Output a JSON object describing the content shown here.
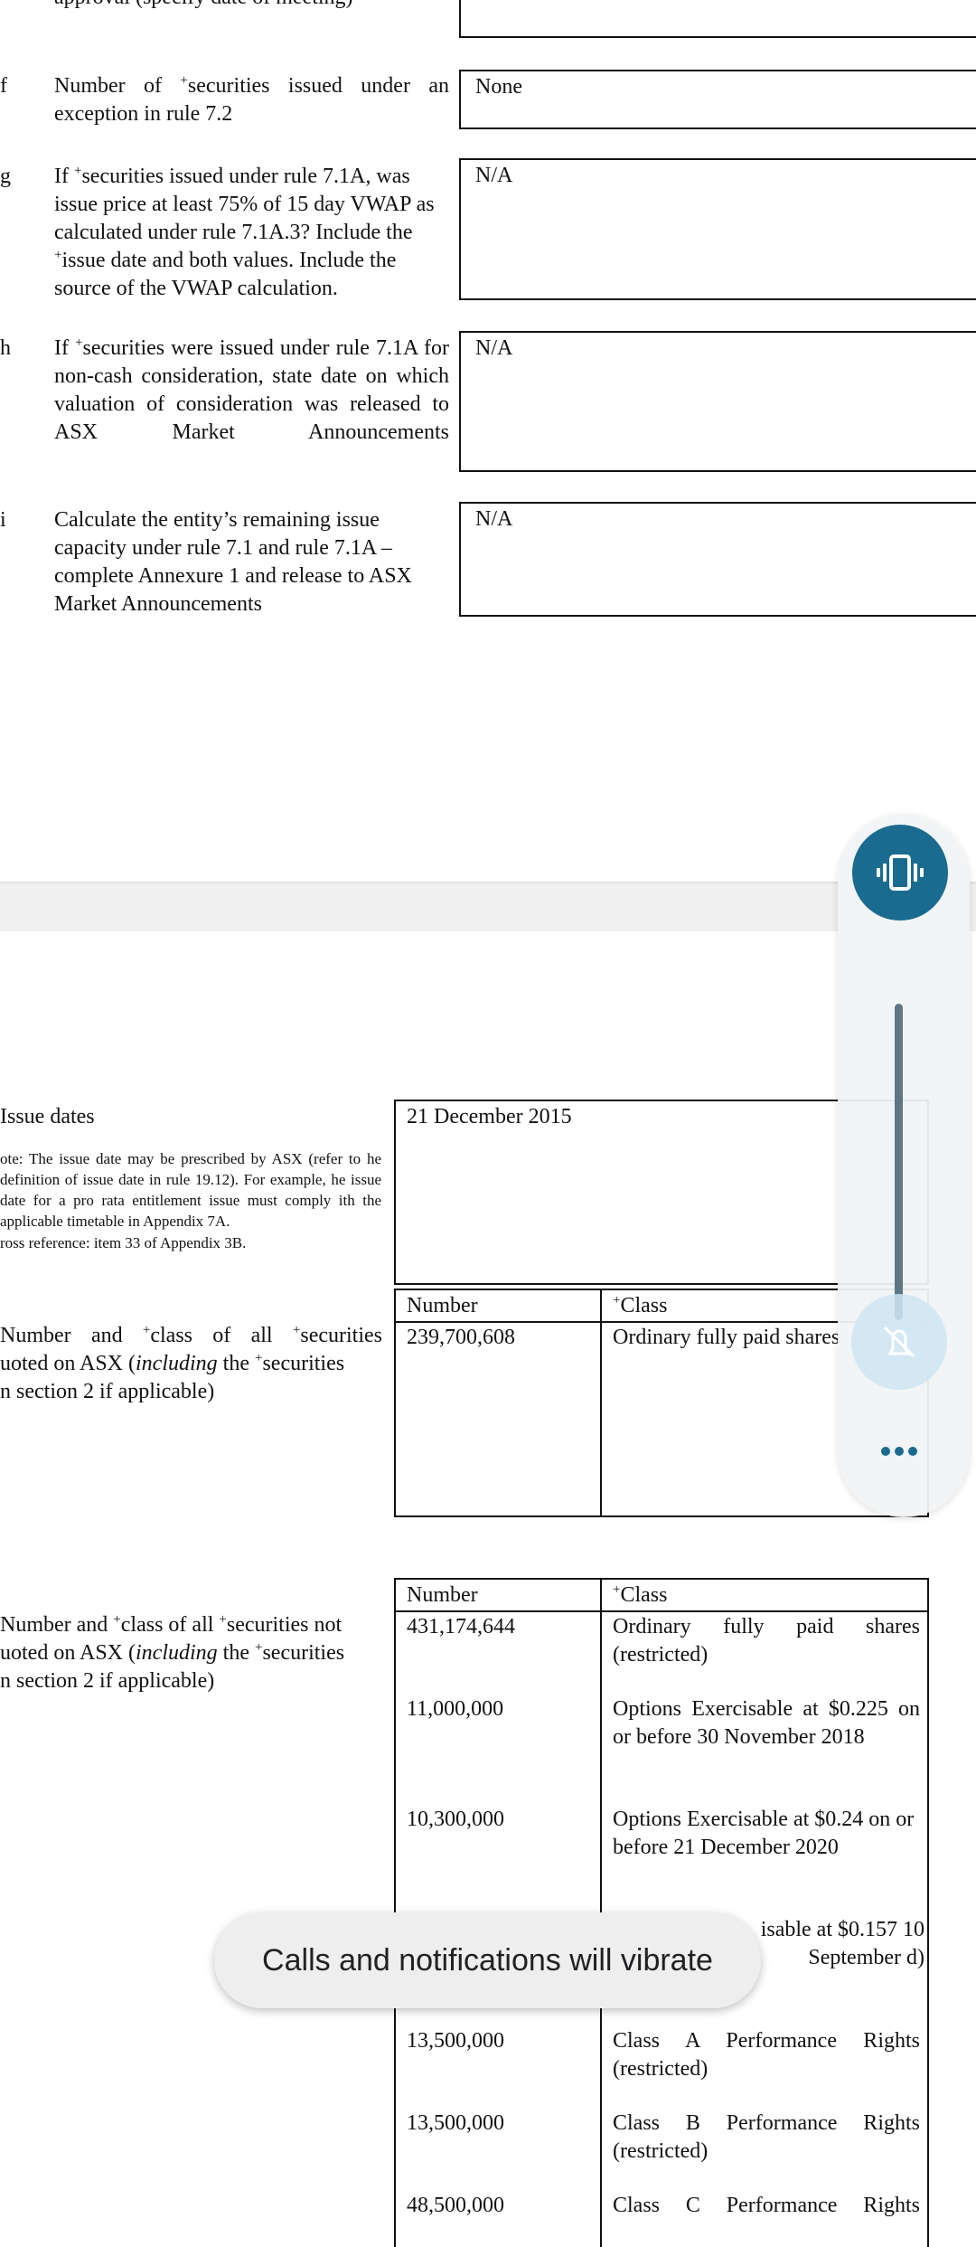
{
  "page1": {
    "cut_top_text": "approval (specify date of meeting)",
    "rows": [
      {
        "letter": "f",
        "pre": "Number of ",
        "sup": "+",
        "post": "securities issued under an exception in rule 7.2",
        "value": "None"
      },
      {
        "letter": "g",
        "pre": "If ",
        "sup": "+",
        "post": "securities issued under rule 7.1A, was issue price at least 75% of 15 day VWAP as calculated under rule 7.1A.3? Include the ",
        "sup2": "+",
        "post2": "issue date and both values. Include the source of the VWAP calculation.",
        "value": "N/A"
      },
      {
        "letter": "h",
        "pre": "If ",
        "sup": "+",
        "post": "securities were issued under rule 7.1A for non-cash consideration, state date on which valuation of consideration was released to ASX Market Announcements",
        "value": "N/A"
      },
      {
        "letter": "i",
        "pre": "Calculate the entity’s remaining issue capacity under rule 7.1 and rule 7.1A – complete Annexure 1 and release to ASX Market Announcements",
        "value": "N/A"
      }
    ]
  },
  "page2": {
    "issue_dates_label": "Issue dates",
    "issue_dates_note": "ote: The issue date may be prescribed by ASX (refer to he definition of issue date in rule 19.12). For example, he issue date for a pro rata entitlement issue must comply ith the applicable timetable in Appendix 7A.",
    "issue_dates_cross": "ross reference: item 33 of Appendix 3B.",
    "issue_date_value": "21 December 2015",
    "quoted": {
      "label_lines": [
        "Number and ",
        "class of all ",
        "securities",
        "uoted on ASX (",
        "including",
        " the ",
        "securities",
        "n section 2 if applicable)"
      ],
      "header_number": "Number",
      "header_class": "Class",
      "rows": [
        {
          "number": "239,700,608",
          "class": "Ordinary fully paid shares"
        }
      ]
    },
    "not_quoted": {
      "header_number": "Number",
      "header_class": "Class",
      "rows": [
        {
          "number": "431,174,644",
          "class": "Ordinary fully paid shares (restricted)"
        },
        {
          "number": "11,000,000",
          "class": "Options Exercisable at $0.225 on or before 30 November 2018"
        },
        {
          "number": "10,300,000",
          "class": "Options Exercisable at $0.24 on or before 21 December 2020"
        },
        {
          "number": "",
          "class": "isable at $0.157 10 September d)"
        },
        {
          "number": "13,500,000",
          "class": "Class A Performance Rights (restricted)"
        },
        {
          "number": "13,500,000",
          "class": "Class B Performance Rights (restricted)"
        },
        {
          "number": "48,500,000",
          "class": "Class C Performance Rights"
        }
      ]
    }
  },
  "volume_panel": {
    "mode_icon": "vibrate-icon",
    "mute_icon": "notifications-off-icon",
    "more_icon": "more-dots-icon"
  },
  "toast": {
    "text": "Calls and notifications will vibrate"
  },
  "colors": {
    "accent": "#1a6b8f",
    "panel_bg": "#f1f3f4",
    "slider_track": "#5f7785",
    "mute_bg": "#cfe5f3",
    "toast_bg": "#eeeeee"
  }
}
